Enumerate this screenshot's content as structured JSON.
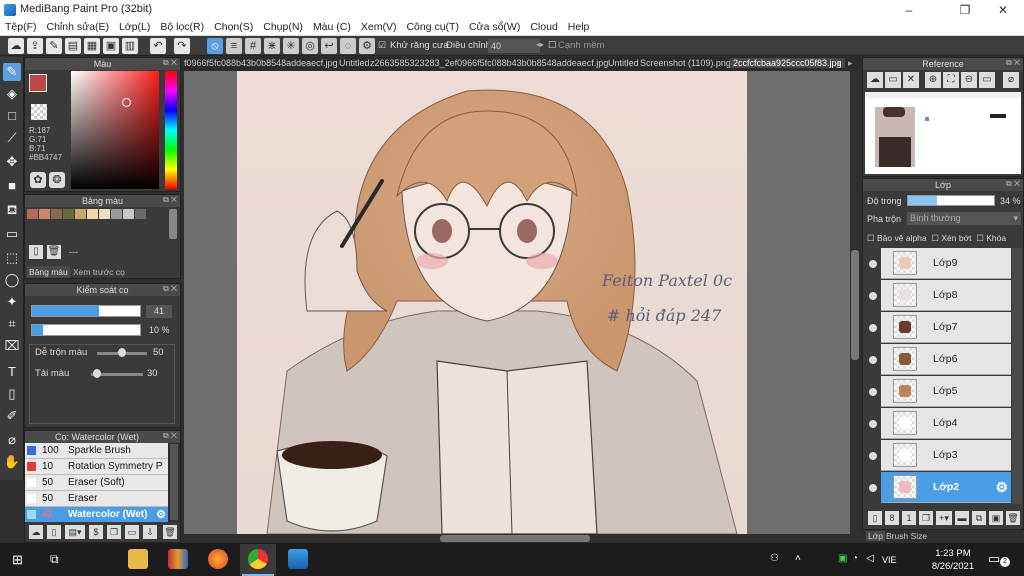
{
  "window": {
    "title": "MediBang Paint Pro (32bit)",
    "minimize": "–",
    "maximize": "❐",
    "close": "✕"
  },
  "menu": [
    "Tệp(F)",
    "Chỉnh sửa(E)",
    "Lớp(L)",
    "Bộ lọc(R)",
    "Chọn(S)",
    "Chụp(N)",
    "Màu (C)",
    "Xem(V)",
    "Công cụ(T)",
    "Cửa sổ(W)",
    "Cloud",
    "Help"
  ],
  "toolbar": {
    "antialias_label": "Khử răng cưa",
    "adjust_label": "Điều chỉnh",
    "adjust_value": "40",
    "snap_label": "Cạnh mềm"
  },
  "tabs": [
    "f0966f5fc088b43b0b8548addeaecf.jpg",
    "Untitled",
    "z2663585323283_2ef0966f5fc088b43b0b8548addeaecf.jpg",
    "Untitled",
    "Screenshot (1109).png",
    "2ccfcfcbaa925ccc05f83.jpg"
  ],
  "color_panel": {
    "title": "Màu",
    "r": "R:187",
    "g": "G:71",
    "b": "B:71",
    "hex": "#BB4747",
    "current_color": "#BB4747"
  },
  "palette_panel": {
    "title": "Bảng màu",
    "tab_palette": "Bảng màu",
    "tab_preview": "Xem trước cọ",
    "placeholder": "---",
    "swatches": [
      "#b86a5a",
      "#c98a6a",
      "#8a6a4a",
      "#6a6a3a",
      "#c8a86a",
      "#f0d8a8",
      "#e8e0c0",
      "#9a9a9a",
      "#c8c8c8",
      "#6a6a6a"
    ]
  },
  "brush_control": {
    "title": "Kiểm soát cọ",
    "size_value": "41",
    "opacity_value": "10 %",
    "size_fraction": 0.62,
    "opacity_fraction": 0.1,
    "mix_label": "Dễ trộn màu",
    "mix_value": "50",
    "load_label": "Tải màu",
    "load_value": "30"
  },
  "brush_list": {
    "title": "Cọ: Watercolor (Wet)",
    "items": [
      {
        "size": "100",
        "name": "Sparkle Brush",
        "color": "#3a6ae0"
      },
      {
        "size": "10",
        "name": "Rotation Symmetry P",
        "color": "#e03a3a"
      },
      {
        "size": "50",
        "name": "Eraser (Soft)",
        "color": "#ffffff"
      },
      {
        "size": "50",
        "name": "Eraser",
        "color": "#ffffff"
      },
      {
        "size": "41",
        "name": "Watercolor (Wet)",
        "color": "#a0d8f0"
      }
    ]
  },
  "reference_panel": {
    "title": "Reference"
  },
  "layer_panel": {
    "title": "Lớp",
    "opacity_label": "Độ trong",
    "opacity_value": "34 %",
    "opacity_fraction": 0.34,
    "blend_label": "Pha trộn",
    "blend_value": "Bình thường",
    "protect_alpha": "Bảo vệ alpha",
    "clip": "Xén bớt",
    "lock": "Khóa",
    "layers": [
      "Lớp9",
      "Lớp8",
      "Lớp7",
      "Lớp6",
      "Lớp5",
      "Lớp4",
      "Lớp3",
      "Lớp2"
    ]
  },
  "bottom_tabs": {
    "layer": "Lớp",
    "brush_size": "Brush Size"
  },
  "canvas_text": {
    "line1": "Feiton Paxtel 0c",
    "line2": "# hỏi đáp 247"
  },
  "taskbar": {
    "lang": "VIE",
    "time": "1:23 PM",
    "date": "8/26/2021",
    "notifications": "2"
  }
}
